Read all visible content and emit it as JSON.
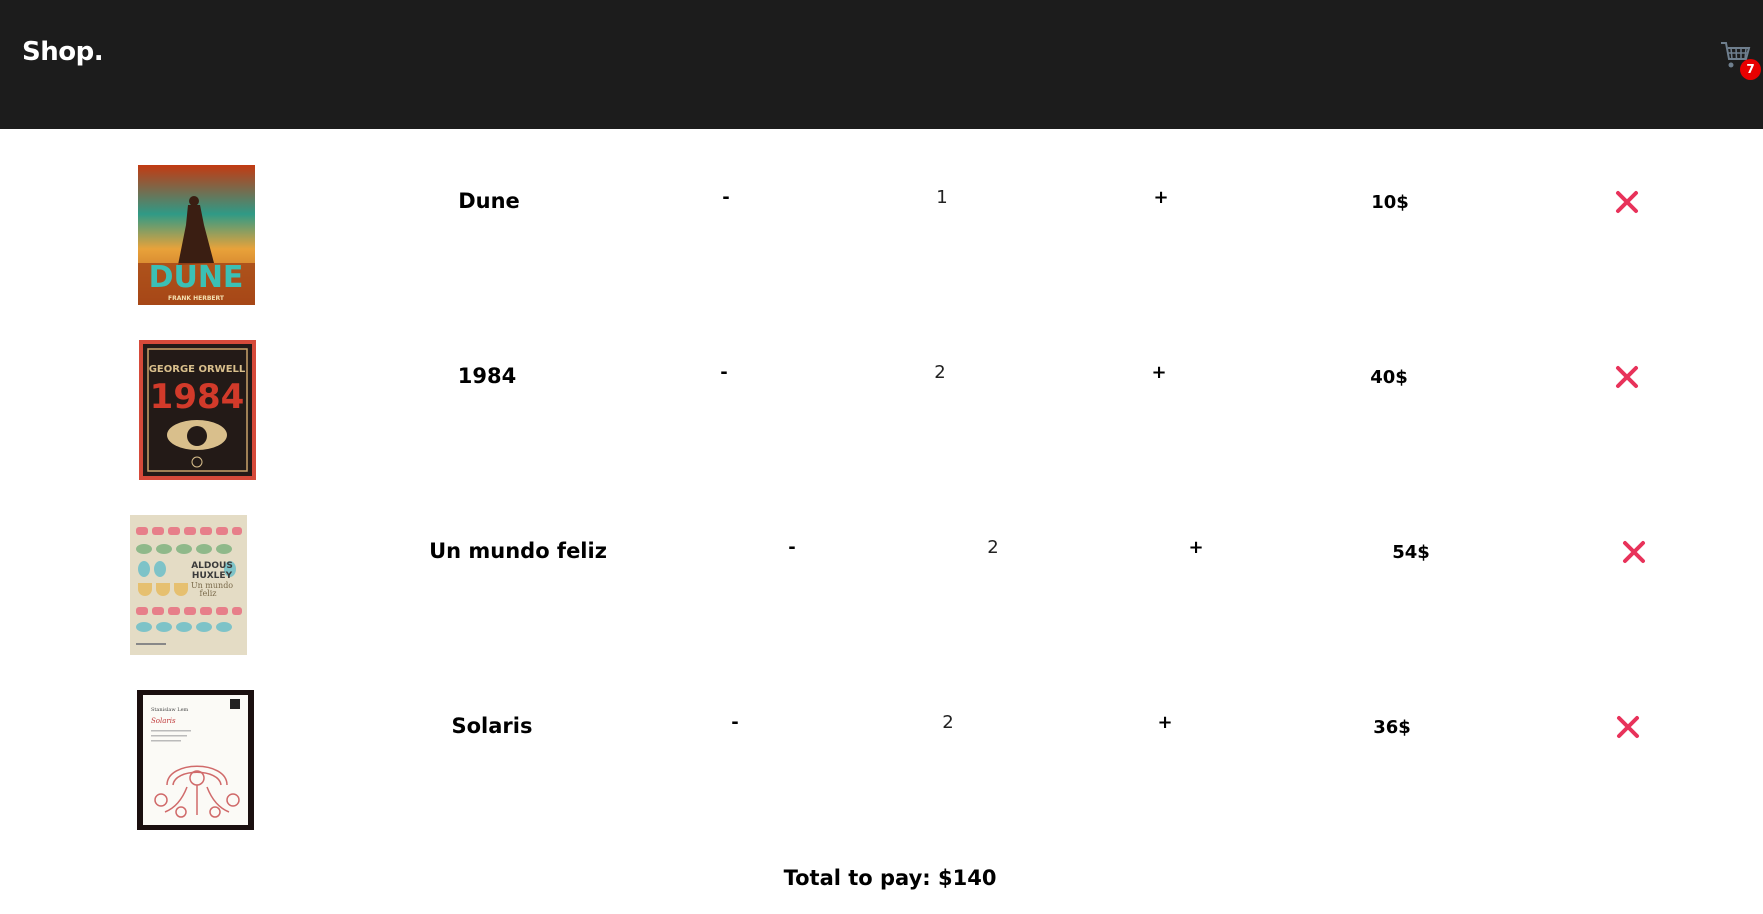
{
  "header": {
    "brand": "Shop.",
    "cart_icon": "shopping-cart-icon",
    "cart_count": "7",
    "badge_color": "#e80000"
  },
  "cart": {
    "decrement_label": "-",
    "increment_label": "+",
    "remove_icon": "close-x-icon",
    "remove_color": "#e8325a",
    "items": [
      {
        "title": "Dune",
        "quantity": "1",
        "price": "10$",
        "cover_text": [
          "DUNE",
          "FRANK HERBERT"
        ]
      },
      {
        "title": "1984",
        "quantity": "2",
        "price": "40$",
        "cover_text": [
          "GEORGE ORWELL",
          "1984"
        ]
      },
      {
        "title": "Un mundo feliz",
        "quantity": "2",
        "price": "54$",
        "cover_text": [
          "ALDOUS",
          "HUXLEY",
          "Un mundo",
          "feliz"
        ]
      },
      {
        "title": "Solaris",
        "quantity": "2",
        "price": "36$",
        "cover_text": [
          "Stanislaw Lem",
          "Solaris"
        ]
      }
    ]
  },
  "summary": {
    "total_label": "Total to pay:",
    "total_value": "$140"
  }
}
